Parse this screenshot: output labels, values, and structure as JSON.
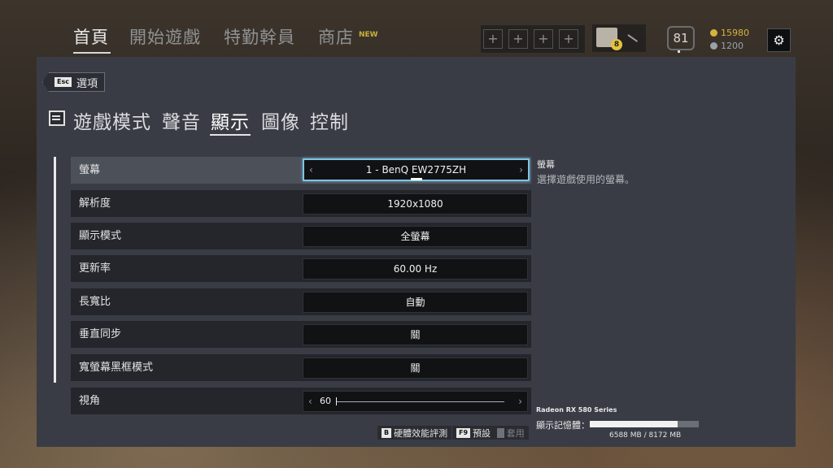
{
  "topnav": {
    "items": [
      "首頁",
      "開始遊戲",
      "特勤幹員",
      "商店"
    ],
    "new_tag": "NEW",
    "plus_slots": [
      "+",
      "+",
      "+",
      "+"
    ],
    "avatar_badge": "8",
    "level": "81",
    "r6_credits": "15980",
    "renown": "1200",
    "colors": {
      "accent_gold": "#d7b33b",
      "renown_grey": "#9aa1a8"
    }
  },
  "back_button": {
    "key": "Esc",
    "label": "選項"
  },
  "tabs": [
    "遊戲模式",
    "聲音",
    "顯示",
    "圖像",
    "控制"
  ],
  "active_tab": "顯示",
  "settings": [
    {
      "label": "螢幕",
      "value": "1 - BenQ EW2775ZH"
    },
    {
      "label": "解析度",
      "value": "1920x1080"
    },
    {
      "label": "顯示模式",
      "value": "全螢幕"
    },
    {
      "label": "更新率",
      "value": "60.00 Hz"
    },
    {
      "label": "長寬比",
      "value": "自動"
    },
    {
      "label": "垂直同步",
      "value": "關"
    },
    {
      "label": "寬螢幕黑框模式",
      "value": "關"
    },
    {
      "label": "視角",
      "value": "60",
      "slider_fraction": 0.0
    }
  ],
  "arrows": {
    "left": "‹",
    "right": "›"
  },
  "help": {
    "title": "螢幕",
    "description": "選擇遊戲使用的螢幕。"
  },
  "gpu": {
    "name": "Radeon RX 580 Series",
    "vram_label": "顯示記憶體：",
    "vram_used": 6588,
    "vram_total": 8172,
    "vram_text": "6588 MB / 8172 MB",
    "colors": {
      "accent_select": "#7fc4e6"
    }
  },
  "footer": {
    "benchmark": {
      "key": "B",
      "label": "硬體效能評測"
    },
    "defaults": {
      "key": "F9",
      "label": "預設"
    },
    "apply": {
      "key": "",
      "label": "套用"
    }
  }
}
